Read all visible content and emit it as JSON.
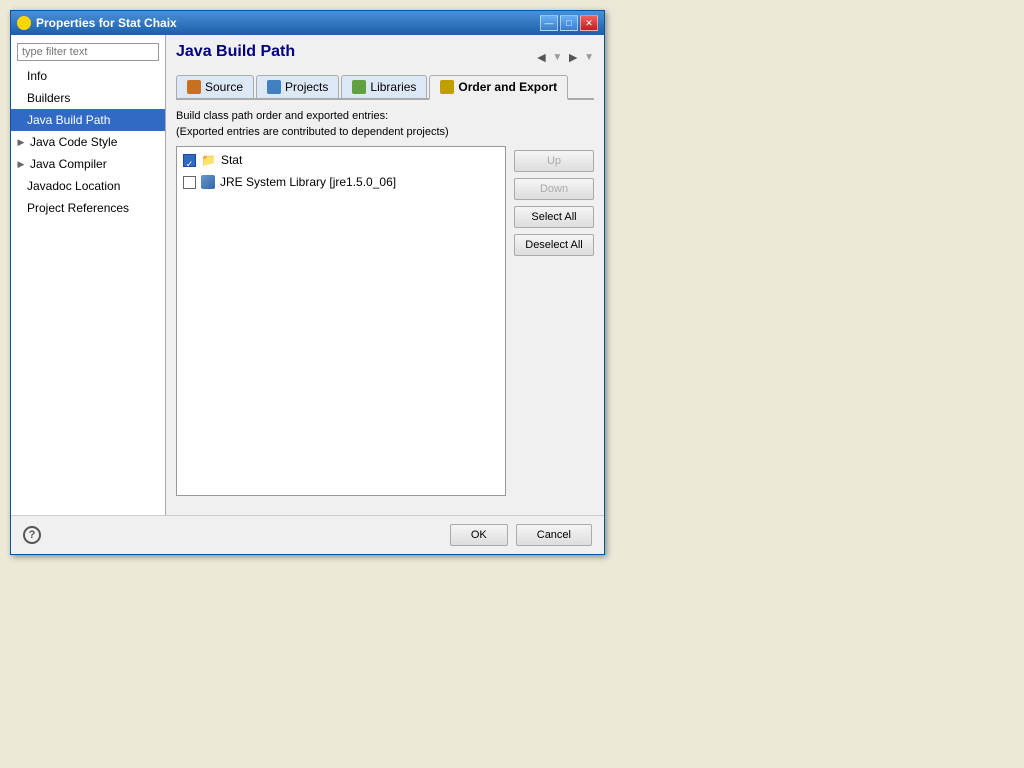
{
  "window": {
    "title": "Properties for Stat Chaix",
    "icon": "gear-icon"
  },
  "sidebar": {
    "filter_placeholder": "type filter text",
    "items": [
      {
        "id": "info",
        "label": "Info",
        "indent": 1,
        "expandable": false
      },
      {
        "id": "builders",
        "label": "Builders",
        "indent": 1,
        "expandable": false
      },
      {
        "id": "java-build-path",
        "label": "Java Build Path",
        "indent": 1,
        "expandable": false,
        "selected": true
      },
      {
        "id": "java-code-style",
        "label": "Java Code Style",
        "indent": 0,
        "expandable": true
      },
      {
        "id": "java-compiler",
        "label": "Java Compiler",
        "indent": 0,
        "expandable": true
      },
      {
        "id": "javadoc-location",
        "label": "Javadoc Location",
        "indent": 1,
        "expandable": false
      },
      {
        "id": "project-references",
        "label": "Project References",
        "indent": 1,
        "expandable": false
      }
    ]
  },
  "content": {
    "title": "Java Build Path",
    "tabs": [
      {
        "id": "source",
        "label": "Source",
        "icon": "source-tab-icon"
      },
      {
        "id": "projects",
        "label": "Projects",
        "icon": "projects-tab-icon"
      },
      {
        "id": "libraries",
        "label": "Libraries",
        "icon": "libraries-tab-icon"
      },
      {
        "id": "order-and-export",
        "label": "Order and Export",
        "icon": "order-tab-icon",
        "active": true
      }
    ],
    "description_line1": "Build class path order and exported entries:",
    "description_line2": "(Exported entries are contributed to dependent projects)",
    "list_items": [
      {
        "id": "stat-entry",
        "label": "Stat",
        "checked": true,
        "icon": "folder-icon"
      },
      {
        "id": "jre-entry",
        "label": "JRE System Library [jre1.5.0_06]",
        "checked": false,
        "icon": "jre-icon"
      }
    ],
    "buttons": {
      "up": "Up",
      "down": "Down",
      "select_all": "Select All",
      "deselect_all": "Deselect All"
    }
  },
  "footer": {
    "ok": "OK",
    "cancel": "Cancel"
  }
}
